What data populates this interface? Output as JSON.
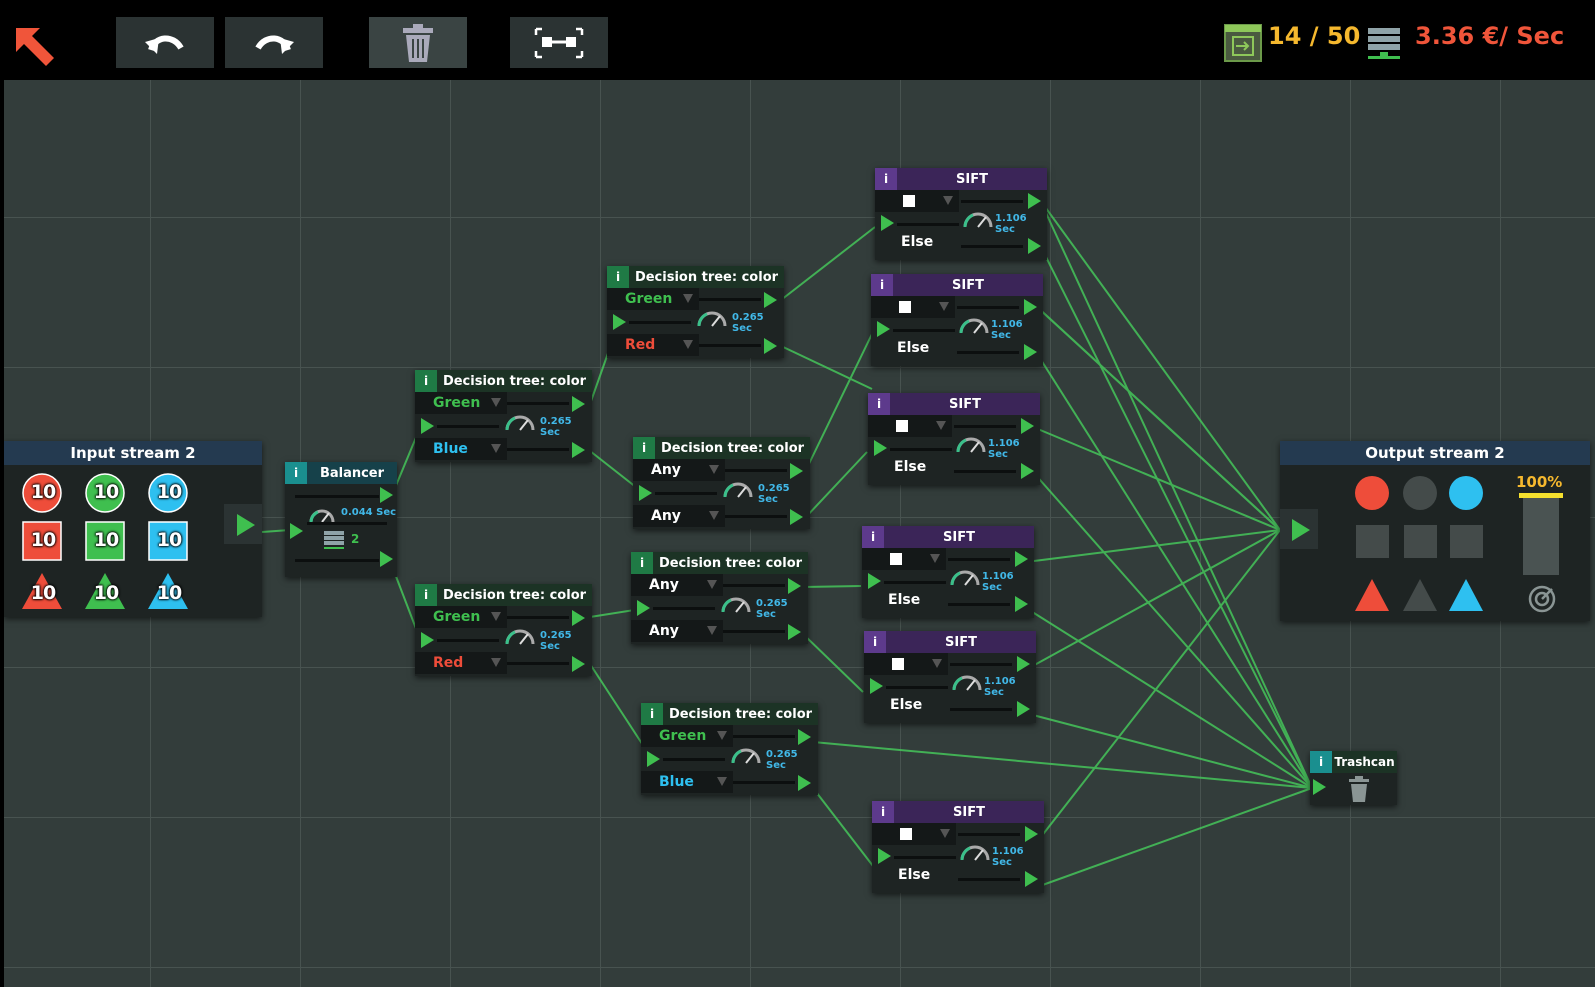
{
  "toolbar": {
    "back_icon": "back-arrow-icon",
    "undo_icon": "undo-icon",
    "redo_icon": "redo-icon",
    "trash_icon": "trash-icon",
    "layout_icon": "auto-layout-icon",
    "node_count": "14 / 50",
    "rate": "3.36 €/ Sec",
    "accent": "#f5b82e",
    "rate_color": "#f0553a"
  },
  "input_stream": {
    "title": "Input stream 2",
    "counts": [
      "10",
      "10",
      "10",
      "10",
      "10",
      "10",
      "10",
      "10",
      "10"
    ]
  },
  "balancer": {
    "title": "Balancer",
    "speed": "0.044 Sec",
    "outputs": "2"
  },
  "dt1": {
    "title": "Decision tree: color",
    "opt_a": "Green",
    "opt_b": "Blue",
    "speed": "0.265 Sec"
  },
  "dt2": {
    "title": "Decision tree: color",
    "opt_a": "Green",
    "opt_b": "Red",
    "speed": "0.265 Sec"
  },
  "dt3": {
    "title": "Decision tree: color",
    "opt_a": "Green",
    "opt_b": "Red",
    "speed": "0.265 Sec"
  },
  "dt4": {
    "title": "Decision tree: color",
    "opt_a": "Any",
    "opt_b": "Any",
    "speed": "0.265 Sec"
  },
  "dt5": {
    "title": "Decision tree: color",
    "opt_a": "Any",
    "opt_b": "Any",
    "speed": "0.265 Sec"
  },
  "dt6": {
    "title": "Decision tree: color",
    "opt_a": "Green",
    "opt_b": "Blue",
    "speed": "0.265 Sec"
  },
  "sift": {
    "title": "SIFT",
    "else": "Else",
    "speed": "1.106 Sec",
    "info": "i"
  },
  "info_label": "i",
  "output_stream": {
    "title": "Output stream 2",
    "percent": "100%"
  },
  "trashcan": {
    "title": "Trashcan"
  },
  "colors": {
    "red": "#ee4d3a",
    "green": "#3fbf4f",
    "blue": "#2ec0f0",
    "grey": "#444b4a",
    "wire": "#45c55a"
  }
}
